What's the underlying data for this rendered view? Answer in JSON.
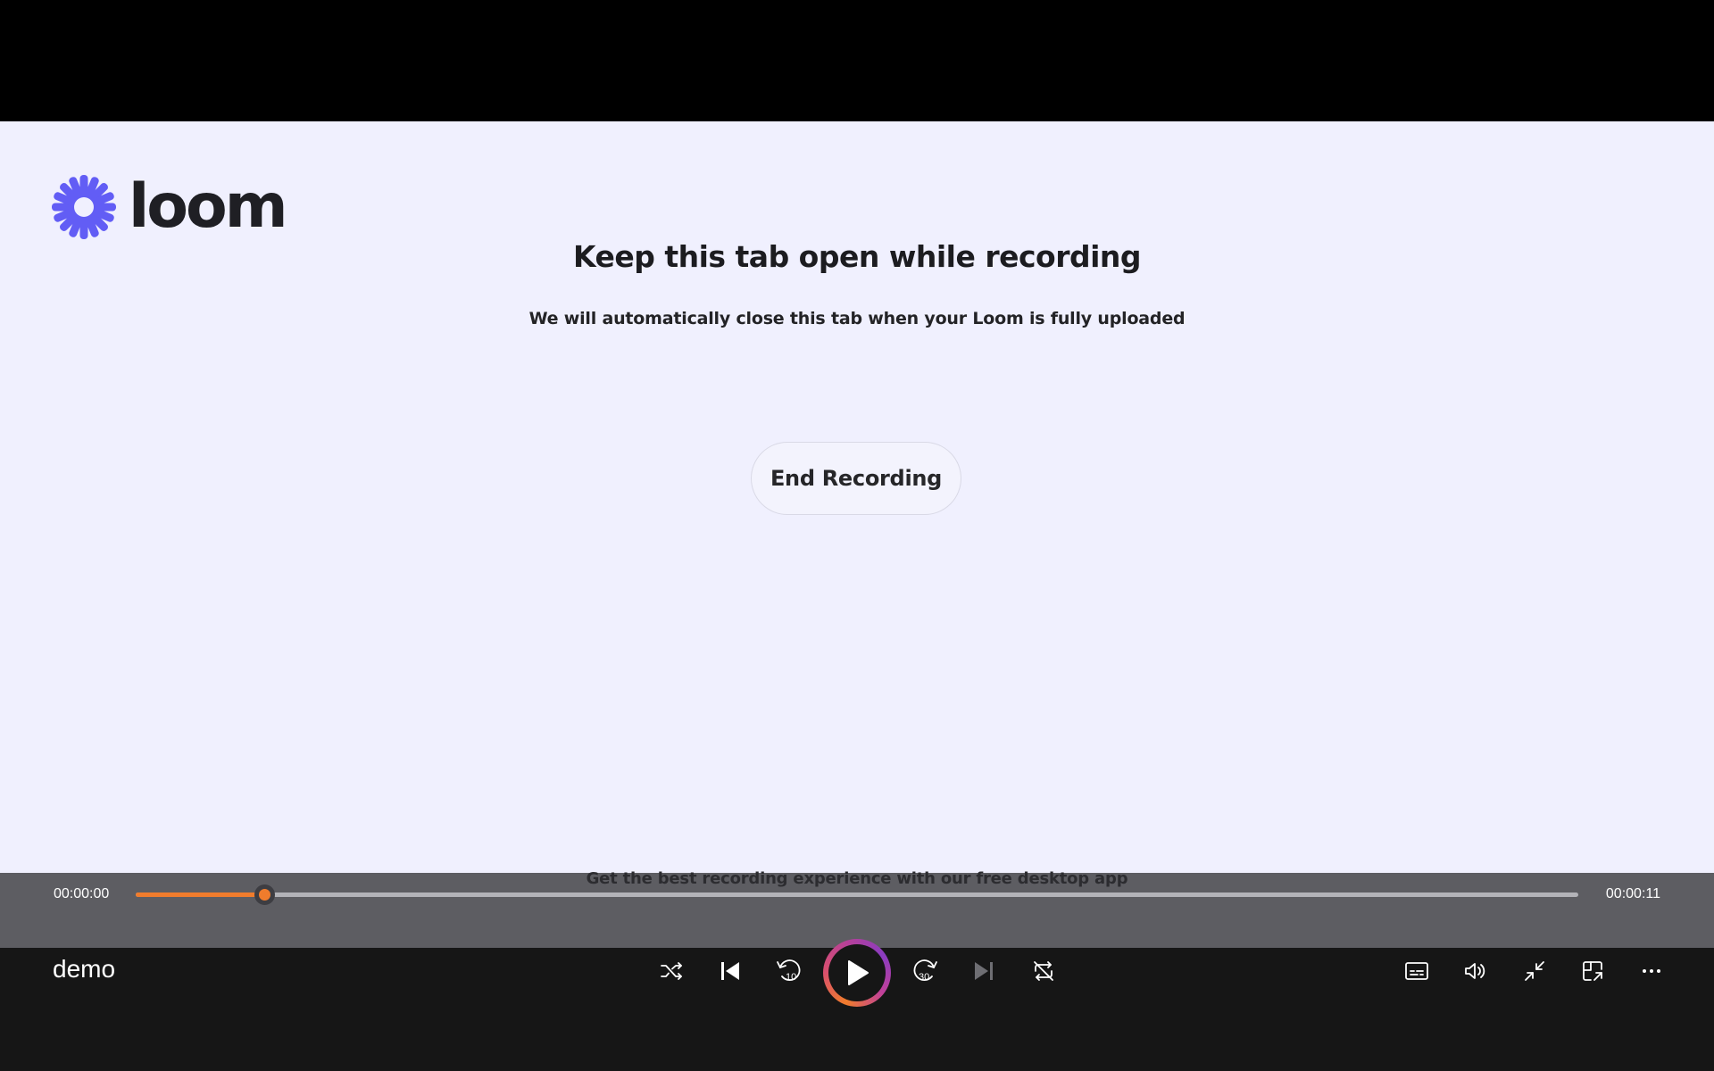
{
  "page": {
    "headline": "Keep this tab open while recording",
    "subline": "We will automatically close this tab when your Loom is fully uploaded",
    "end_button_label": "End Recording",
    "promo": "Get the best recording experience with our free desktop app",
    "logo_text": "loom"
  },
  "player": {
    "title": "demo",
    "current_time": "00:00:00",
    "total_time": "00:00:11",
    "progress_fraction": 0.089,
    "accent_color": "#f07c2c",
    "controls": [
      {
        "name": "shuffle-icon"
      },
      {
        "name": "previous-icon"
      },
      {
        "name": "rewind-10-icon",
        "label": "10"
      },
      {
        "name": "play-icon"
      },
      {
        "name": "forward-30-icon",
        "label": "30"
      },
      {
        "name": "next-icon"
      },
      {
        "name": "repeat-off-icon"
      }
    ],
    "right_controls": [
      {
        "name": "captions-icon"
      },
      {
        "name": "volume-icon"
      },
      {
        "name": "exit-fullscreen-icon"
      },
      {
        "name": "miniplayer-icon"
      },
      {
        "name": "more-icon"
      }
    ]
  },
  "colors": {
    "page_background": "#f0f0fe",
    "logo_purple": "#625df5"
  }
}
